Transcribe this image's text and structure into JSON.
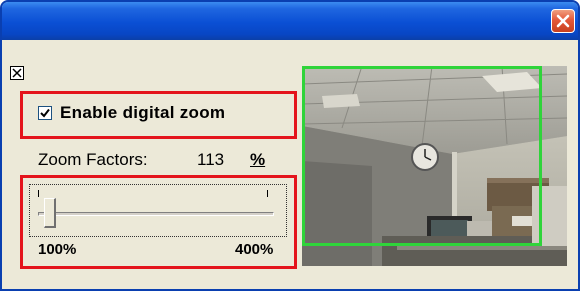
{
  "window": {
    "title": "",
    "close_icon": "close-icon"
  },
  "panel": {
    "hide_icon": "checkbox-x-icon"
  },
  "zoom": {
    "enable_label": "Enable digital zoom",
    "enabled": true,
    "factor_label": "Zoom Factors:",
    "factor_value": "113",
    "factor_unit": "%",
    "min_label": "100%",
    "max_label": "400%",
    "min": 100,
    "max": 400,
    "value": 113
  },
  "colors": {
    "highlight": "#e4141c",
    "zoom_region": "#2fd43a",
    "titlebar": "#0a4fd4"
  }
}
